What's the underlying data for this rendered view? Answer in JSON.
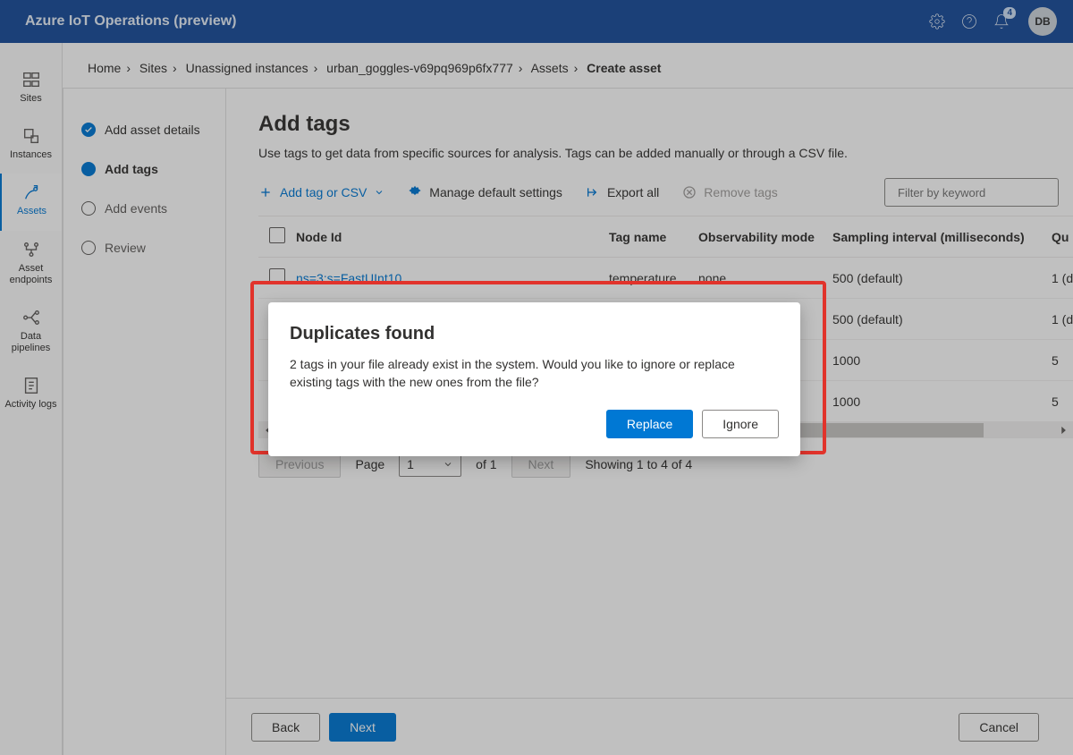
{
  "header": {
    "title": "Azure IoT Operations (preview)",
    "notif_count": "4",
    "avatar_initials": "DB"
  },
  "nav": {
    "items": [
      {
        "label": "Sites"
      },
      {
        "label": "Instances"
      },
      {
        "label": "Assets"
      },
      {
        "label": "Asset endpoints"
      },
      {
        "label": "Data pipelines"
      },
      {
        "label": "Activity logs"
      }
    ]
  },
  "breadcrumb": {
    "items": [
      "Home",
      "Sites",
      "Unassigned instances",
      "urban_goggles-v69pq969p6fx777",
      "Assets"
    ],
    "current": "Create asset"
  },
  "steps": [
    {
      "label": "Add asset details",
      "state": "done"
    },
    {
      "label": "Add tags",
      "state": "active"
    },
    {
      "label": "Add events",
      "state": "pending"
    },
    {
      "label": "Review",
      "state": "pending"
    }
  ],
  "page": {
    "title": "Add tags",
    "desc": "Use tags to get data from specific sources for analysis. Tags can be added manually or through a CSV file."
  },
  "cmdbar": {
    "add": "Add tag or CSV",
    "manage": "Manage default settings",
    "export": "Export all",
    "remove": "Remove tags",
    "filter_placeholder": "Filter by keyword"
  },
  "table": {
    "columns": [
      "Node Id",
      "Tag name",
      "Observability mode",
      "Sampling interval (milliseconds)",
      "Qu"
    ],
    "rows": [
      {
        "node": "ns=3;s=FastUInt10",
        "tag": "temperature",
        "obs": "none",
        "interval": "500 (default)",
        "qu": "1 (d"
      },
      {
        "node": "",
        "tag": "",
        "obs": "",
        "interval": "500 (default)",
        "qu": "1 (d"
      },
      {
        "node": "",
        "tag": "",
        "obs": "",
        "interval": "1000",
        "qu": "5"
      },
      {
        "node": "",
        "tag": "",
        "obs": "",
        "interval": "1000",
        "qu": "5"
      }
    ]
  },
  "pager": {
    "prev": "Previous",
    "next": "Next",
    "page_label": "Page",
    "page_value": "1",
    "of_label": "of 1",
    "showing": "Showing 1 to 4 of 4"
  },
  "footer": {
    "back": "Back",
    "next": "Next",
    "cancel": "Cancel"
  },
  "dialog": {
    "title": "Duplicates found",
    "body": "2 tags in your file already exist in the system. Would you like to ignore or replace existing tags with the new ones from the file?",
    "replace": "Replace",
    "ignore": "Ignore"
  }
}
